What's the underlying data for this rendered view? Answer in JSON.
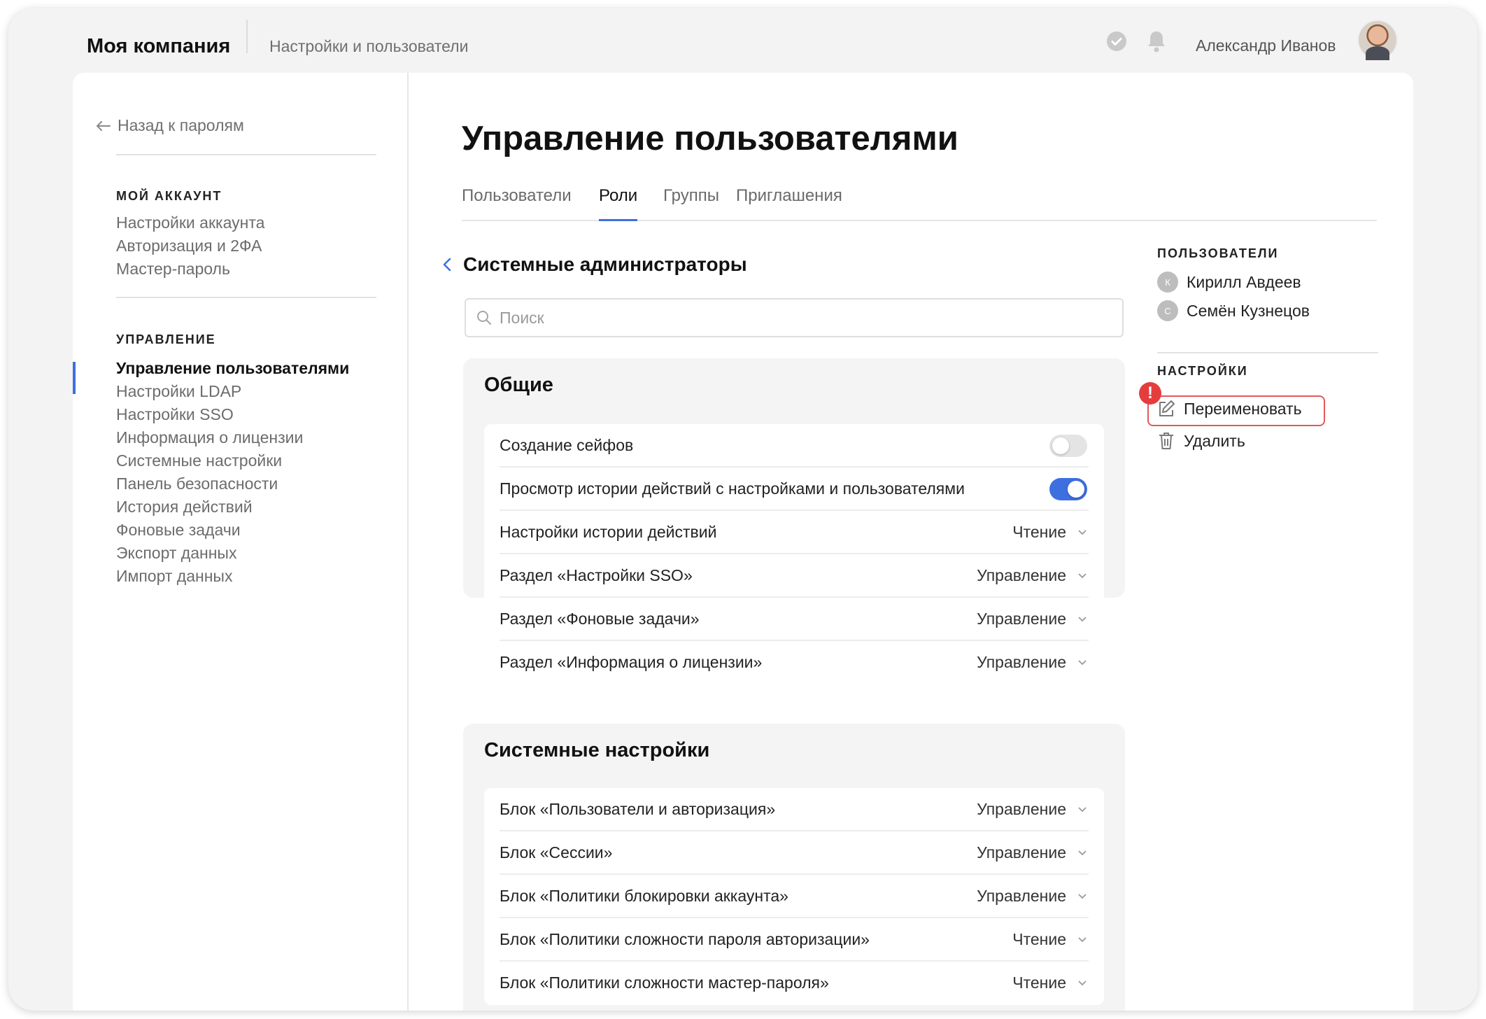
{
  "header": {
    "brand": "Моя компания",
    "breadcrumb": "Настройки и пользователи",
    "user_name": "Александр Иванов"
  },
  "sidebar": {
    "back_label": "Назад к паролям",
    "account_heading": "МОЙ АККАУНТ",
    "account_items": [
      "Настройки аккаунта",
      "Авторизация и 2ФА",
      "Мастер-пароль"
    ],
    "manage_heading": "УПРАВЛЕНИЕ",
    "manage_items": [
      "Управление пользователями",
      "Настройки LDAP",
      "Настройки SSO",
      "Информация о лицензии",
      "Системные настройки",
      "Панель безопасности",
      "История действий",
      "Фоновые задачи",
      "Экспорт данных",
      "Импорт данных"
    ],
    "active_index": 0
  },
  "main": {
    "title": "Управление пользователями",
    "tabs": [
      "Пользователи",
      "Роли",
      "Группы",
      "Приглашения"
    ],
    "active_tab": 1,
    "role_title": "Системные администраторы",
    "search_placeholder": "Поиск",
    "sections": [
      {
        "title": "Общие",
        "rows": [
          {
            "label": "Создание сейфов",
            "toggle": false
          },
          {
            "label": "Просмотр истории действий с настройками и пользователями",
            "toggle": true
          },
          {
            "label": "Настройки истории действий",
            "value": "Чтение"
          },
          {
            "label": "Раздел «Настройки SSO»",
            "value": "Управление"
          },
          {
            "label": "Раздел «Фоновые задачи»",
            "value": "Управление"
          },
          {
            "label": "Раздел «Информация о лицензии»",
            "value": "Управление"
          }
        ]
      },
      {
        "title": "Системные настройки",
        "rows": [
          {
            "label": "Блок «Пользователи и авторизация»",
            "value": "Управление"
          },
          {
            "label": "Блок «Сессии»",
            "value": "Управление"
          },
          {
            "label": "Блок «Политики блокировки аккаунта»",
            "value": "Управление"
          },
          {
            "label": "Блок «Политики сложности пароля авторизации»",
            "value": "Чтение"
          },
          {
            "label": "Блок «Политики сложности мастер-пароля»",
            "value": "Чтение"
          }
        ]
      }
    ]
  },
  "right_panel": {
    "users_heading": "ПОЛЬЗОВАТЕЛИ",
    "users": [
      {
        "initial": "К",
        "name": "Кирилл Авдеев"
      },
      {
        "initial": "С",
        "name": "Семён Кузнецов"
      }
    ],
    "settings_heading": "НАСТРОЙКИ",
    "rename_label": "Переименовать",
    "delete_label": "Удалить",
    "alert_mark": "!"
  },
  "colors": {
    "accent": "#3d6fe0",
    "alert": "#e53d3d"
  }
}
